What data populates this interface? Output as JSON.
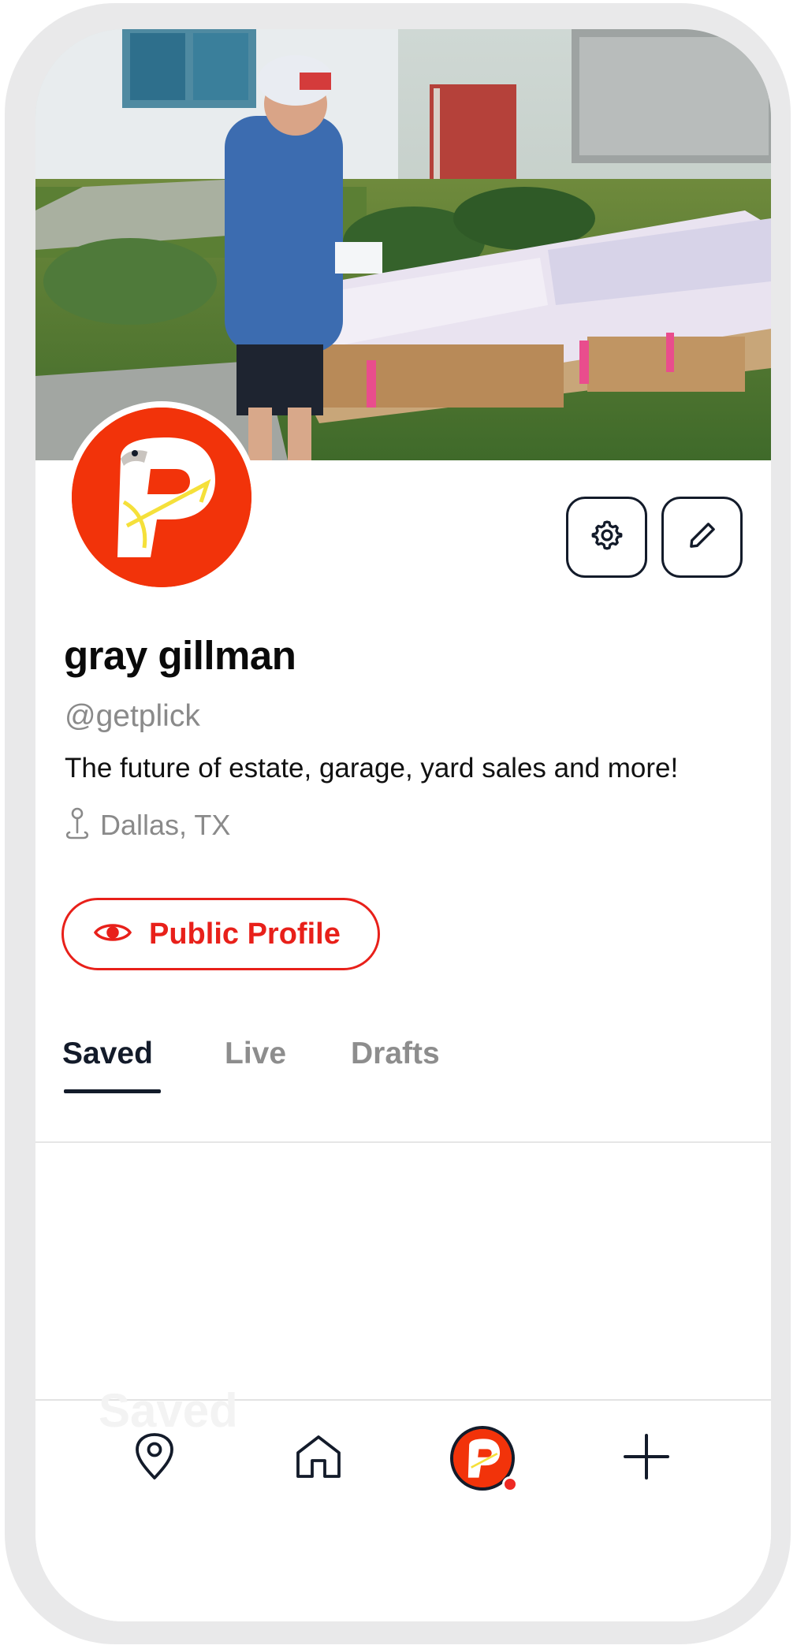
{
  "colors": {
    "accent": "#e8201a",
    "brand": "#f2330a",
    "ink": "#131b2a",
    "muted": "#8a8a8a",
    "notification": "#ee2a24"
  },
  "cover": {
    "image": "estate-sale-photo"
  },
  "profile": {
    "avatar_icon": "plick-logo-icon",
    "name": "gray gillman",
    "handle": "@getplick",
    "bio": "The future of estate, garage, yard sales and more!",
    "location": "Dallas, TX",
    "location_icon": "map-pin-icon"
  },
  "actions": {
    "settings_icon": "gear-icon",
    "edit_icon": "pencil-icon",
    "public_profile_label": "Public Profile",
    "public_profile_icon": "eye-icon"
  },
  "tabs": [
    {
      "label": "Saved",
      "active": true
    },
    {
      "label": "Live",
      "active": false
    },
    {
      "label": "Drafts",
      "active": false
    }
  ],
  "bottom_nav": {
    "ghost_label": "Saved",
    "items": [
      {
        "icon": "map-pin-icon"
      },
      {
        "icon": "home-icon"
      },
      {
        "icon": "profile-avatar-icon",
        "has_notification": true
      },
      {
        "icon": "plus-icon"
      }
    ]
  }
}
